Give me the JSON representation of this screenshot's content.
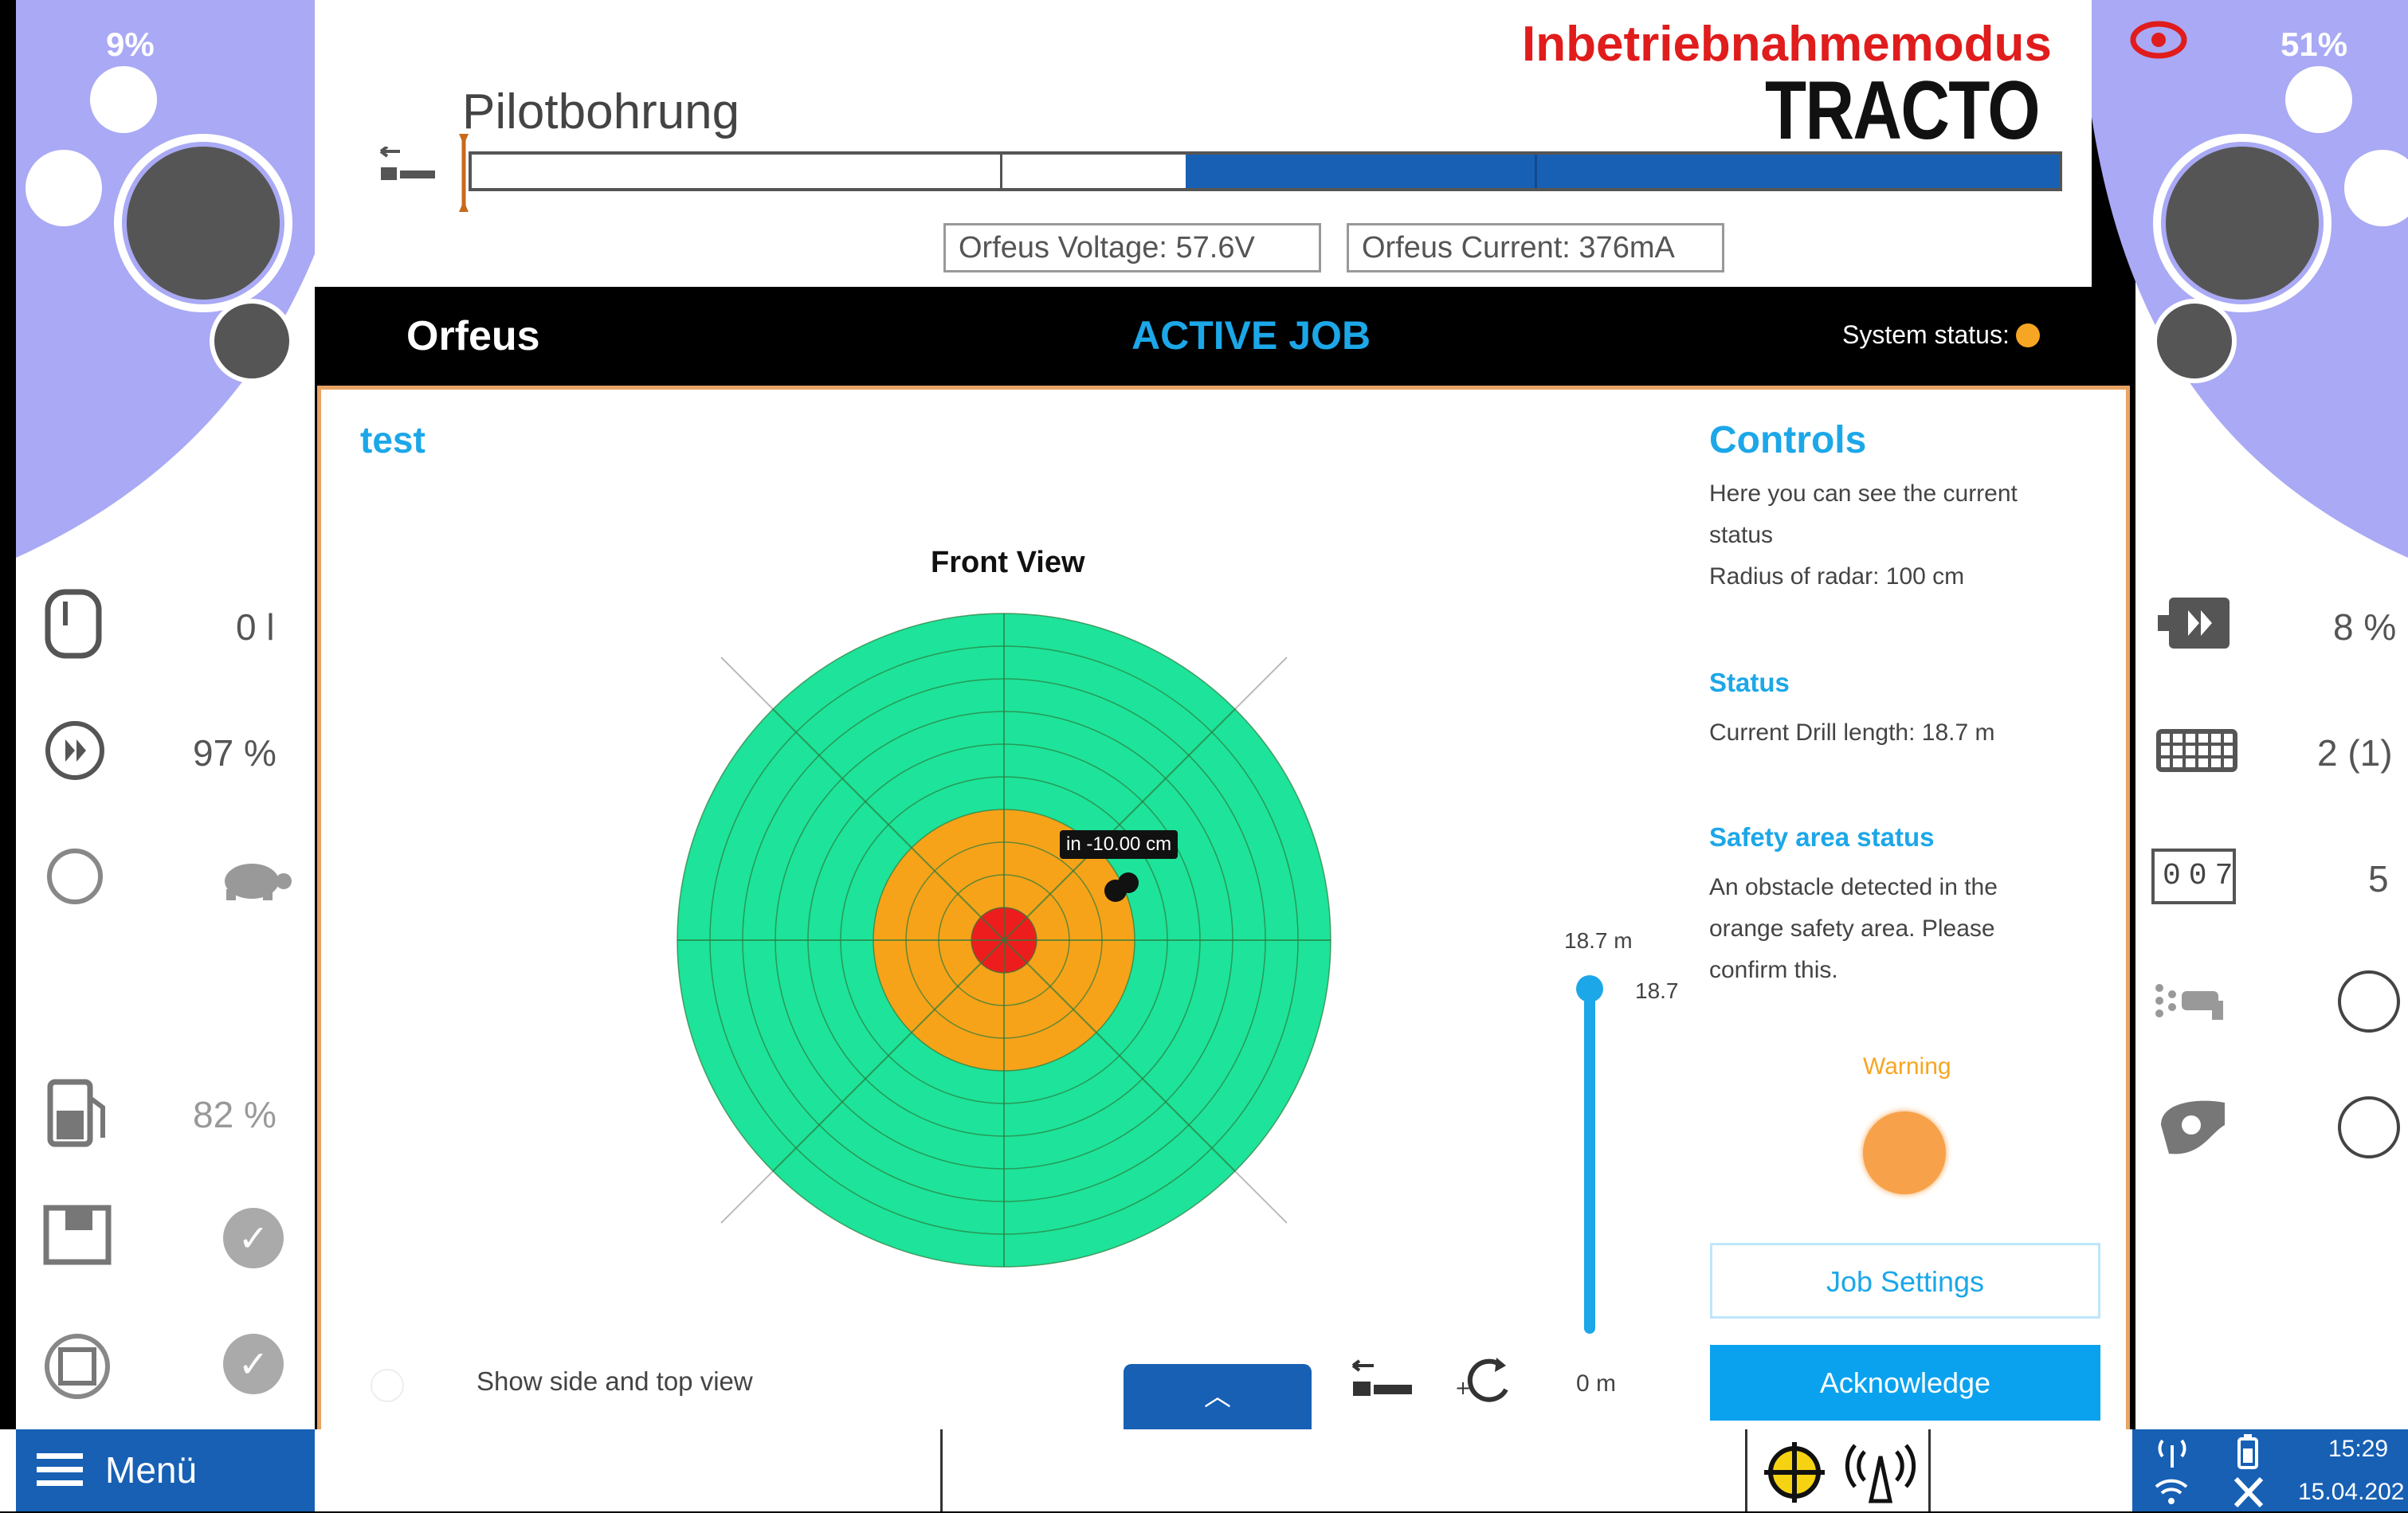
{
  "header": {
    "title": "Pilotbohrung",
    "mode_label": "Inbetriebnahmemodus",
    "brand": "TRACTO",
    "left_percent": "9%",
    "right_percent": "51%",
    "voltage_text": "Orfeus Voltage: 57.6V",
    "current_text": "Orfeus Current: 376mA"
  },
  "progress": {
    "fraction_filled": 0.55,
    "color": "#1760b4"
  },
  "appbar": {
    "app_name": "Orfeus",
    "active_job": "ACTIVE JOB",
    "system_status_label": "System status:",
    "system_status_color": "#f6a623"
  },
  "job": {
    "name": "test"
  },
  "front_view": {
    "title": "Front View",
    "target_label": "in -10.00 cm",
    "colors": {
      "outer": "#1ee39a",
      "safety": "#f6a31a",
      "center": "#ee1d1d"
    }
  },
  "slider": {
    "top_label": "18.7 m",
    "value_label": "18.7",
    "bottom_label": "0 m"
  },
  "controls": {
    "title": "Controls",
    "description": "Here you can see the current status",
    "radius_text": "Radius of radar: 100 cm",
    "status_title": "Status",
    "drill_length_text": "Current Drill length: 18.7 m",
    "safety_title": "Safety area status",
    "safety_text": "An obstacle detected in the orange safety area. Please confirm this.",
    "warning_label": "Warning",
    "job_settings_button": "Job Settings",
    "acknowledge_button": "Acknowledge"
  },
  "bottom_controls": {
    "side_view_label": "Show side and top view",
    "expand_icon": "chevron-up-icon"
  },
  "left_panel": {
    "tank_value": "0 l",
    "rotation_value": "97 %",
    "fuel_value": "82 %"
  },
  "right_panel": {
    "fast_forward_value": "8 %",
    "grid_value": "2 (1)",
    "counter_display": "007",
    "counter_value": "5"
  },
  "menu": {
    "label": "Menü"
  },
  "status_bar": {
    "time": "15:29",
    "date": "15.04.202"
  }
}
